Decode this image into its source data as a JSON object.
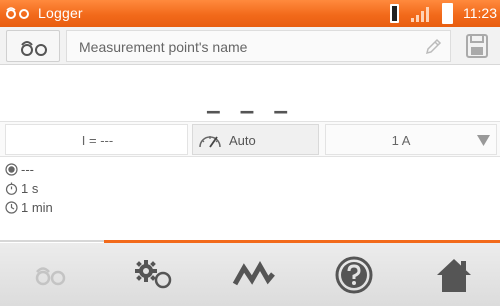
{
  "status_bar": {
    "app_icon": "logger-icon",
    "title": "Logger",
    "time": "11:23",
    "icons": [
      "probe-battery-icon",
      "signal-strength-icon",
      "battery-icon"
    ]
  },
  "name_row": {
    "logger_icon": "logger-icon",
    "name_text": "Measurement point's name",
    "edit_icon": "pencil-icon",
    "save_icon": "save-icon"
  },
  "measurement": {
    "value": "– – –"
  },
  "params": {
    "current": "I = ---",
    "mode_icon": "gauge-icon",
    "mode": "Auto",
    "range": "1 A",
    "range_icon": "dropdown-icon"
  },
  "info": {
    "record": "---",
    "interval": "1 s",
    "duration": "1 min"
  },
  "toolbar": {
    "items": [
      "logger-icon",
      "settings-icon",
      "waveform-icon",
      "help-icon",
      "home-icon"
    ]
  },
  "colors": {
    "accent": "#f26a1b",
    "toolbar_bg": "#e0e0e0",
    "icon_dark": "#555555"
  }
}
